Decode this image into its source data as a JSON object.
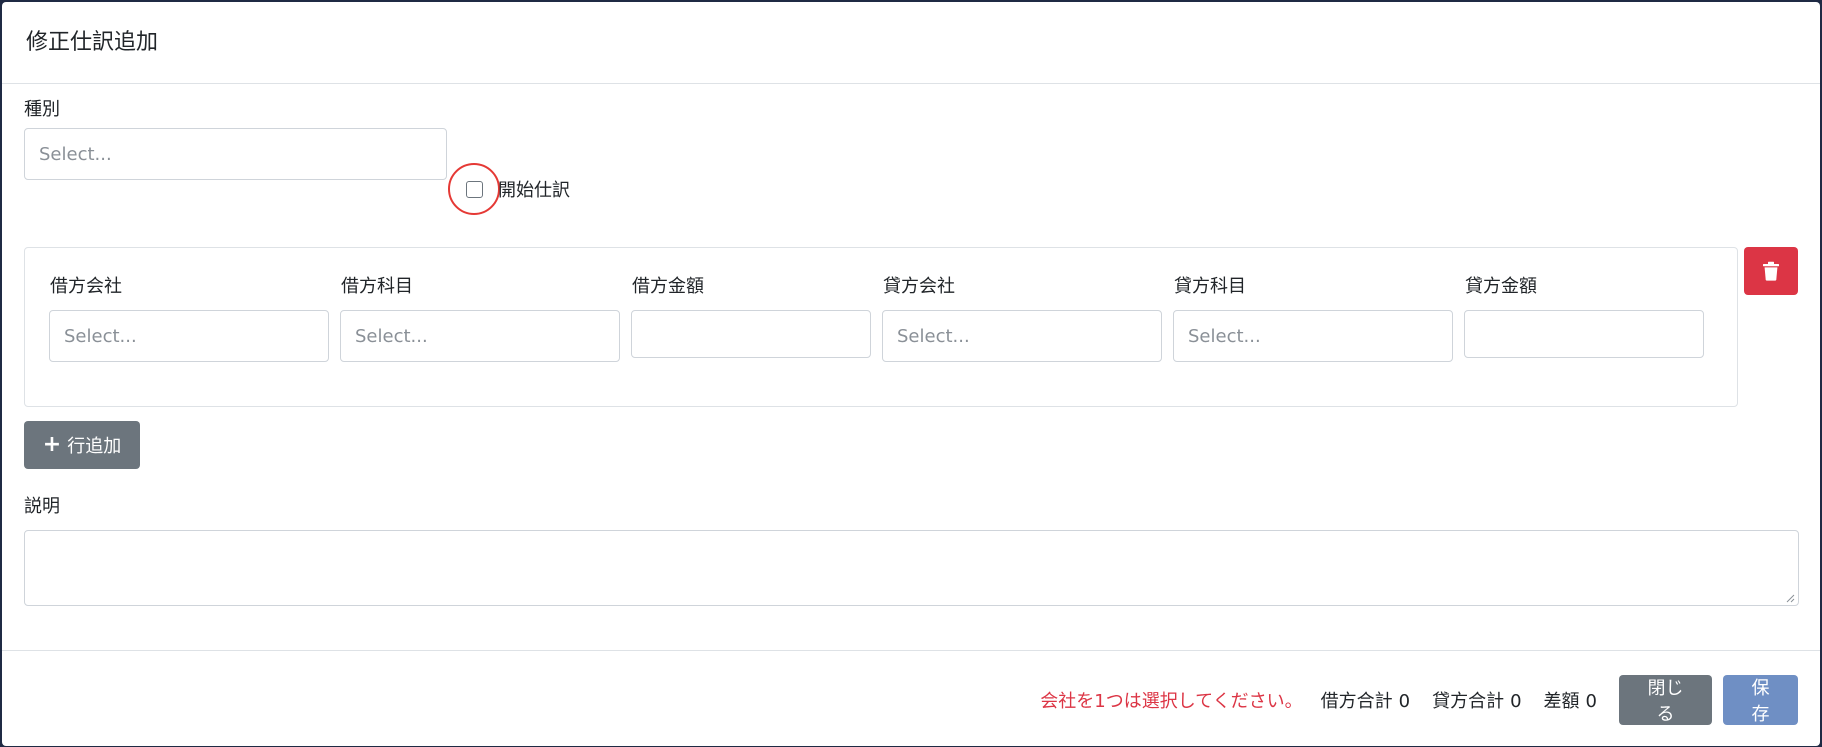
{
  "modal": {
    "title": "修正仕訳追加"
  },
  "type_field": {
    "label": "種別",
    "placeholder": "Select..."
  },
  "opening_entry": {
    "label": "開始仕訳",
    "checked": false
  },
  "lines": {
    "headers": {
      "debit_company": "借方会社",
      "debit_account": "借方科目",
      "debit_amount": "借方金額",
      "credit_company": "貸方会社",
      "credit_account": "貸方科目",
      "credit_amount": "貸方金額"
    },
    "rows": [
      {
        "debit_company": "Select...",
        "debit_account": "Select...",
        "debit_amount": "",
        "credit_company": "Select...",
        "credit_account": "Select...",
        "credit_amount": ""
      }
    ]
  },
  "add_row": {
    "label": "行追加",
    "icon": "plus-icon"
  },
  "description": {
    "label": "説明",
    "value": ""
  },
  "footer": {
    "warning": "会社を1つは選択してください。",
    "debit_total_label": "借方合計",
    "debit_total": "0",
    "credit_total_label": "貸方合計",
    "credit_total": "0",
    "diff_label": "差額",
    "diff": "0",
    "close_label": "閉じる",
    "save_label": "保存"
  },
  "colors": {
    "danger": "#dc3545",
    "secondary": "#6c757d",
    "primary_disabled": "#6f8fc4",
    "highlight_ring": "#e53935"
  }
}
